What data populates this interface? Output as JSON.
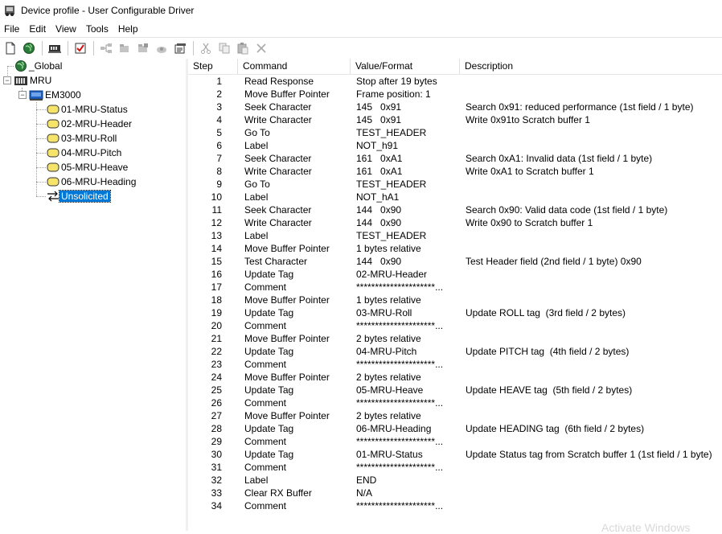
{
  "window": {
    "title": "Device profile - User Configurable Driver",
    "app_icon": "driver-app-icon"
  },
  "menu": [
    "File",
    "Edit",
    "View",
    "Tools",
    "Help"
  ],
  "toolbar": {
    "buttons": [
      "new-document-icon",
      "globe-icon",
      "device-icon",
      "checklist-icon",
      "tree-add-icon",
      "folder-add-icon",
      "folder-copy-icon",
      "camera-add-icon",
      "properties-icon",
      "cut-icon",
      "copy-icon",
      "paste-icon",
      "delete-icon"
    ]
  },
  "tree": {
    "global": "_Global",
    "mru": "MRU",
    "em3000": "EM3000",
    "tags": [
      "01-MRU-Status",
      "02-MRU-Header",
      "03-MRU-Roll",
      "04-MRU-Pitch",
      "05-MRU-Heave",
      "06-MRU-Heading"
    ],
    "unsolicited": "Unsolicited"
  },
  "grid": {
    "headers": {
      "step": "Step",
      "command": "Command",
      "value": "Value/Format",
      "description": "Description"
    },
    "rows": [
      {
        "step": "1",
        "command": "Read Response",
        "value": "Stop after 19 bytes",
        "description": ""
      },
      {
        "step": "2",
        "command": "Move Buffer Pointer",
        "value": "Frame position: 1",
        "description": ""
      },
      {
        "step": "3",
        "command": "Seek Character",
        "value": "145   0x91",
        "description": "Search 0x91: reduced performance (1st field / 1 byte)"
      },
      {
        "step": "4",
        "command": "Write Character",
        "value": "145   0x91",
        "description": "Write 0x91to Scratch buffer 1"
      },
      {
        "step": "5",
        "command": "Go To",
        "value": "TEST_HEADER",
        "description": ""
      },
      {
        "step": "6",
        "command": "Label",
        "value": "NOT_h91",
        "description": ""
      },
      {
        "step": "7",
        "command": "Seek Character",
        "value": "161   0xA1",
        "description": "Search 0xA1: Invalid data (1st field / 1 byte)"
      },
      {
        "step": "8",
        "command": "Write Character",
        "value": "161   0xA1",
        "description": "Write 0xA1 to Scratch buffer 1"
      },
      {
        "step": "9",
        "command": "Go To",
        "value": "TEST_HEADER",
        "description": ""
      },
      {
        "step": "10",
        "command": "Label",
        "value": "NOT_hA1",
        "description": ""
      },
      {
        "step": "11",
        "command": "Seek Character",
        "value": "144   0x90",
        "description": "Search 0x90: Valid data code (1st field / 1 byte)"
      },
      {
        "step": "12",
        "command": "Write Character",
        "value": "144   0x90",
        "description": "Write 0x90 to Scratch buffer 1"
      },
      {
        "step": "13",
        "command": "Label",
        "value": "TEST_HEADER",
        "description": ""
      },
      {
        "step": "14",
        "command": "Move Buffer Pointer",
        "value": "1 bytes relative",
        "description": ""
      },
      {
        "step": "15",
        "command": "Test Character",
        "value": "144   0x90",
        "description": "Test Header field (2nd field / 1 byte) 0x90"
      },
      {
        "step": "16",
        "command": "Update Tag",
        "value": "02-MRU-Header",
        "description": ""
      },
      {
        "step": "17",
        "command": "Comment",
        "value": "*********************...",
        "description": ""
      },
      {
        "step": "18",
        "command": "Move Buffer Pointer",
        "value": "1 bytes relative",
        "description": ""
      },
      {
        "step": "19",
        "command": "Update Tag",
        "value": "03-MRU-Roll",
        "description": "Update ROLL tag  (3rd field / 2 bytes)"
      },
      {
        "step": "20",
        "command": "Comment",
        "value": "*********************...",
        "description": ""
      },
      {
        "step": "21",
        "command": "Move Buffer Pointer",
        "value": "2 bytes relative",
        "description": ""
      },
      {
        "step": "22",
        "command": "Update Tag",
        "value": "04-MRU-Pitch",
        "description": "Update PITCH tag  (4th field / 2 bytes)"
      },
      {
        "step": "23",
        "command": "Comment",
        "value": "*********************...",
        "description": ""
      },
      {
        "step": "24",
        "command": "Move Buffer Pointer",
        "value": "2 bytes relative",
        "description": ""
      },
      {
        "step": "25",
        "command": "Update Tag",
        "value": "05-MRU-Heave",
        "description": "Update HEAVE tag  (5th field / 2 bytes)"
      },
      {
        "step": "26",
        "command": "Comment",
        "value": "*********************...",
        "description": ""
      },
      {
        "step": "27",
        "command": "Move Buffer Pointer",
        "value": "2 bytes relative",
        "description": ""
      },
      {
        "step": "28",
        "command": "Update Tag",
        "value": "06-MRU-Heading",
        "description": "Update HEADING tag  (6th field / 2 bytes)"
      },
      {
        "step": "29",
        "command": "Comment",
        "value": "*********************...",
        "description": ""
      },
      {
        "step": "30",
        "command": "Update Tag",
        "value": "01-MRU-Status",
        "description": "Update Status tag from Scratch buffer 1 (1st field / 1 byte)"
      },
      {
        "step": "31",
        "command": "Comment",
        "value": "*********************...",
        "description": ""
      },
      {
        "step": "32",
        "command": "Label",
        "value": "END",
        "description": ""
      },
      {
        "step": "33",
        "command": "Clear RX Buffer",
        "value": "N/A",
        "description": ""
      },
      {
        "step": "34",
        "command": "Comment",
        "value": "*********************...",
        "description": ""
      }
    ]
  },
  "colors": {
    "selection": "#0078d7",
    "tag_icon": "#f5e36a"
  }
}
